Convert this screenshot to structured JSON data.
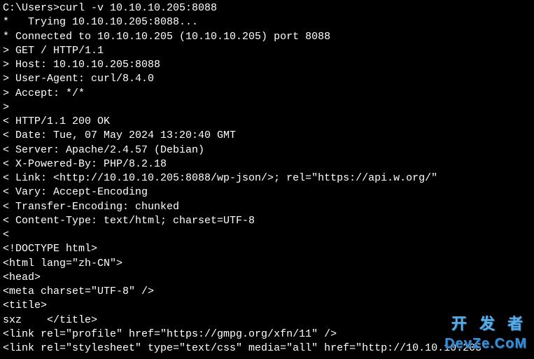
{
  "terminal": {
    "lines": [
      "C:\\Users>curl -v 10.10.10.205:8088",
      "*   Trying 10.10.10.205:8088...",
      "* Connected to 10.10.10.205 (10.10.10.205) port 8088",
      "> GET / HTTP/1.1",
      "> Host: 10.10.10.205:8088",
      "> User-Agent: curl/8.4.0",
      "> Accept: */*",
      ">",
      "< HTTP/1.1 200 OK",
      "< Date: Tue, 07 May 2024 13:20:40 GMT",
      "< Server: Apache/2.4.57 (Debian)",
      "< X-Powered-By: PHP/8.2.18",
      "< Link: <http://10.10.10.205:8088/wp-json/>; rel=\"https://api.w.org/\"",
      "< Vary: Accept-Encoding",
      "< Transfer-Encoding: chunked",
      "< Content-Type: text/html; charset=UTF-8",
      "<",
      "<!DOCTYPE html>",
      "<html lang=\"zh-CN\">",
      "<head>",
      "<meta charset=\"UTF-8\" />",
      "<title>",
      "sxz    </title>",
      "<link rel=\"profile\" href=\"https://gmpg.org/xfn/11\" />",
      "<link rel=\"stylesheet\" type=\"text/css\" media=\"all\" href=\"http://10.10.10.205"
    ]
  },
  "watermark": {
    "top": "开 发 者",
    "bottom": "DevZe.CoM"
  }
}
